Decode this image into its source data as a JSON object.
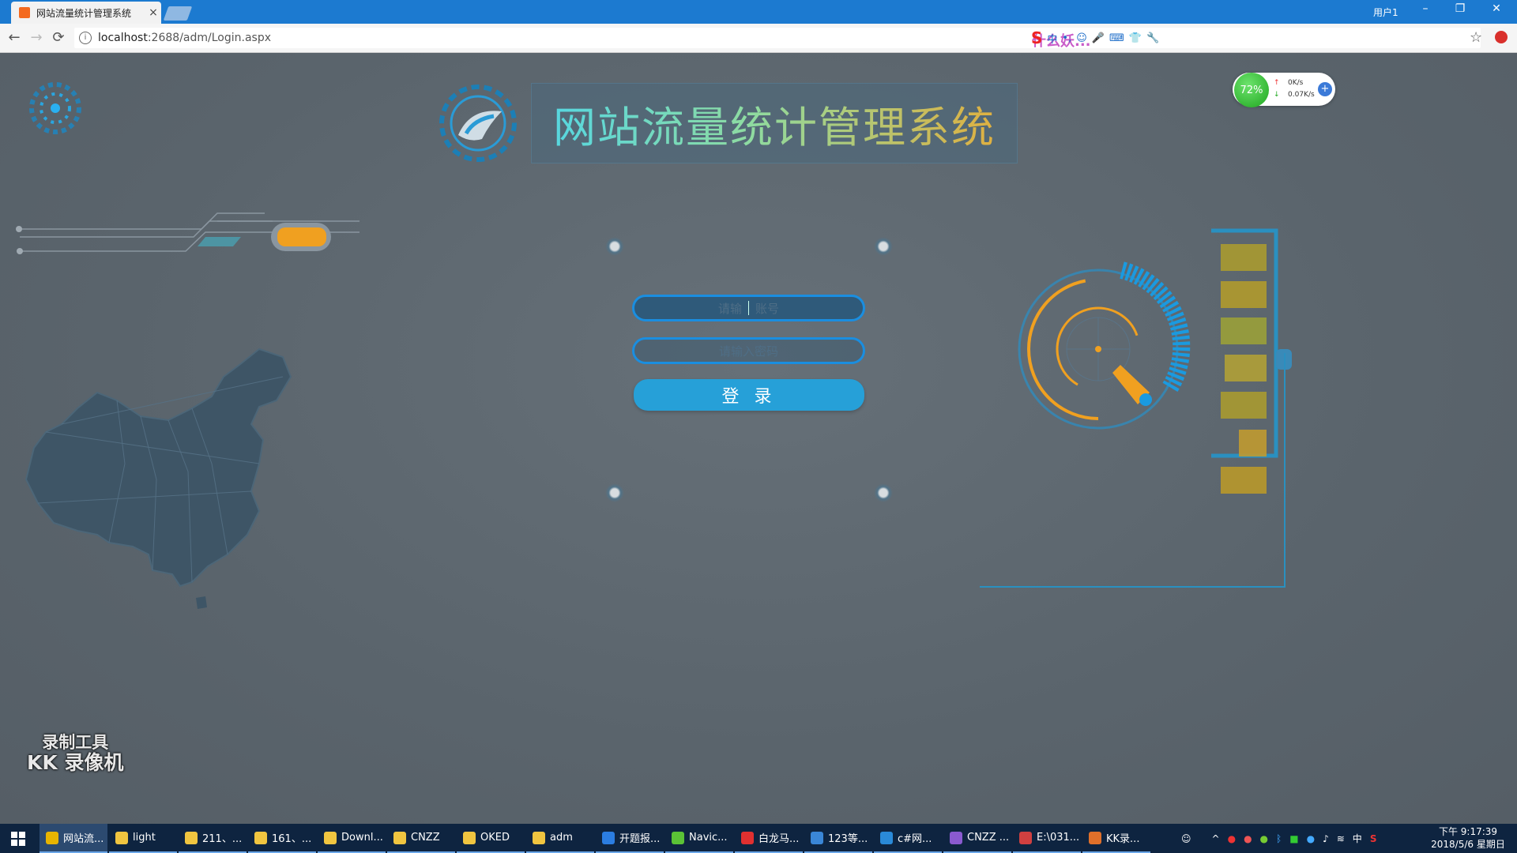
{
  "browser": {
    "tab_title": "网站流量统计管理系统",
    "tab_close": "×",
    "window_user": "用户1",
    "url_host": "localhost",
    "url_path": ":2688/adm/Login.aspx",
    "info_glyph": "i",
    "back_glyph": "←",
    "forward_glyph": "→",
    "reload_glyph": "⟳",
    "star_glyph": "☆",
    "minimize_glyph": "–",
    "restore_glyph": "❐",
    "close_glyph": "✕"
  },
  "ime_toolbar": {
    "logo": "S",
    "lang": "中",
    "punct": "•,",
    "icons": [
      "☺",
      "🎤",
      "⌨",
      "👕",
      "🔧"
    ],
    "banner": "什么妖..."
  },
  "net_widget": {
    "percent": "72%",
    "upload": "0K/s",
    "download": "0.07K/s",
    "up_arrow": "↑",
    "down_arrow": "↓",
    "plus": "+"
  },
  "header": {
    "title": "网站流量统计管理系统"
  },
  "login": {
    "username_ph_left": "请输",
    "username_ph_right": "账号",
    "password_ph": "请输入密码",
    "submit": "登 录"
  },
  "watermark": {
    "line1": "录制工具",
    "line2": "KK 录像机"
  },
  "taskbar": {
    "items": [
      {
        "label": "网站流...",
        "color": "#e8b400"
      },
      {
        "label": "light",
        "color": "#f0c540"
      },
      {
        "label": "211、...",
        "color": "#f0c540"
      },
      {
        "label": "161、...",
        "color": "#f0c540"
      },
      {
        "label": "Downl...",
        "color": "#f0c540"
      },
      {
        "label": "CNZZ",
        "color": "#f0c540"
      },
      {
        "label": "OKED",
        "color": "#f0c540"
      },
      {
        "label": "adm",
        "color": "#f0c540"
      },
      {
        "label": "开题报...",
        "color": "#2b7de1"
      },
      {
        "label": "Navic...",
        "color": "#5bc236"
      },
      {
        "label": "白龙马...",
        "color": "#e03030"
      },
      {
        "label": "123等...",
        "color": "#3a86d6"
      },
      {
        "label": "c#网...",
        "color": "#2a8ad8"
      },
      {
        "label": "CNZZ ...",
        "color": "#8a5ad0"
      },
      {
        "label": "E:\\031...",
        "color": "#d04040"
      },
      {
        "label": "KK录...",
        "color": "#e0702a"
      }
    ],
    "tray_lang": "中",
    "clock_time": "下午 9:17:39",
    "clock_date": "2018/5/6 星期日"
  },
  "colors": {
    "page_bg": "#5a646c",
    "accent_blue": "#1a8ee0",
    "button_blue": "#26a0d8",
    "accent_orange": "#f0a020"
  }
}
